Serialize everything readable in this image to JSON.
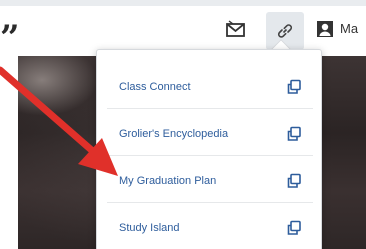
{
  "header": {
    "quote_glyph": "”",
    "user_name": "Ma",
    "icons": [
      "mail-icon",
      "link-icon",
      "user-icon"
    ]
  },
  "links_menu": {
    "items": [
      {
        "label": "Class Connect",
        "icon": "external-window-icon"
      },
      {
        "label": "Grolier's Encyclopedia",
        "icon": "external-window-icon"
      },
      {
        "label": "My Graduation Plan",
        "icon": "external-window-icon"
      },
      {
        "label": "Study Island",
        "icon": "external-window-icon"
      }
    ]
  },
  "colors": {
    "link_text": "#2e5d9c",
    "icon": "#2e5d9c",
    "arrow": "#e0302a",
    "photo_dark": "#2b2424"
  }
}
